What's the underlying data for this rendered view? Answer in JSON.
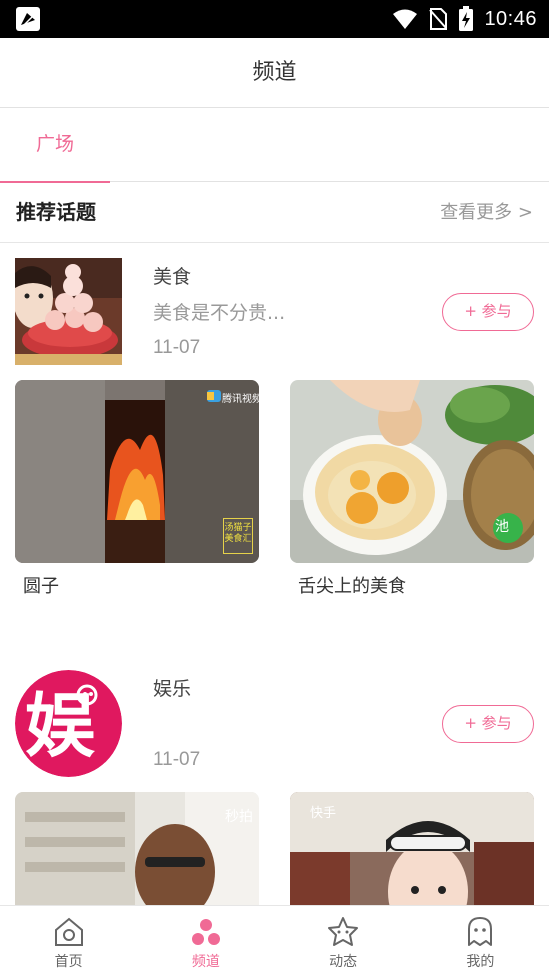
{
  "status_bar": {
    "time": "10:46"
  },
  "header": {
    "title": "频道"
  },
  "tabs": [
    {
      "label": "广场",
      "active": true
    }
  ],
  "section": {
    "title": "推荐话题",
    "see_more": "查看更多 >"
  },
  "topics": [
    {
      "name": "美食",
      "description": "美食是不分贵...",
      "date": "11-07",
      "join_label": "+ 参与",
      "posts": [
        {
          "caption": "圆子",
          "watermark": "腾讯视频",
          "badge_text": "汤猫子\n美食汇"
        },
        {
          "caption": "舌尖上的美食",
          "badge_text": "池"
        }
      ]
    },
    {
      "name": "娱乐",
      "description": "",
      "date": "11-07",
      "join_label": "+ 参与",
      "logo_text": "娱",
      "posts": [
        {
          "caption": "",
          "watermark": "秒拍"
        },
        {
          "caption": "",
          "watermark": "快手"
        }
      ]
    }
  ],
  "bottom_nav": [
    {
      "label": "首页",
      "icon": "home-icon",
      "active": false
    },
    {
      "label": "频道",
      "icon": "channel-dots-icon",
      "active": true
    },
    {
      "label": "动态",
      "icon": "star-face-icon",
      "active": false
    },
    {
      "label": "我的",
      "icon": "ghost-face-icon",
      "active": false
    }
  ],
  "colors": {
    "accent": "#f06a95",
    "ent_logo": "#e0185f"
  }
}
